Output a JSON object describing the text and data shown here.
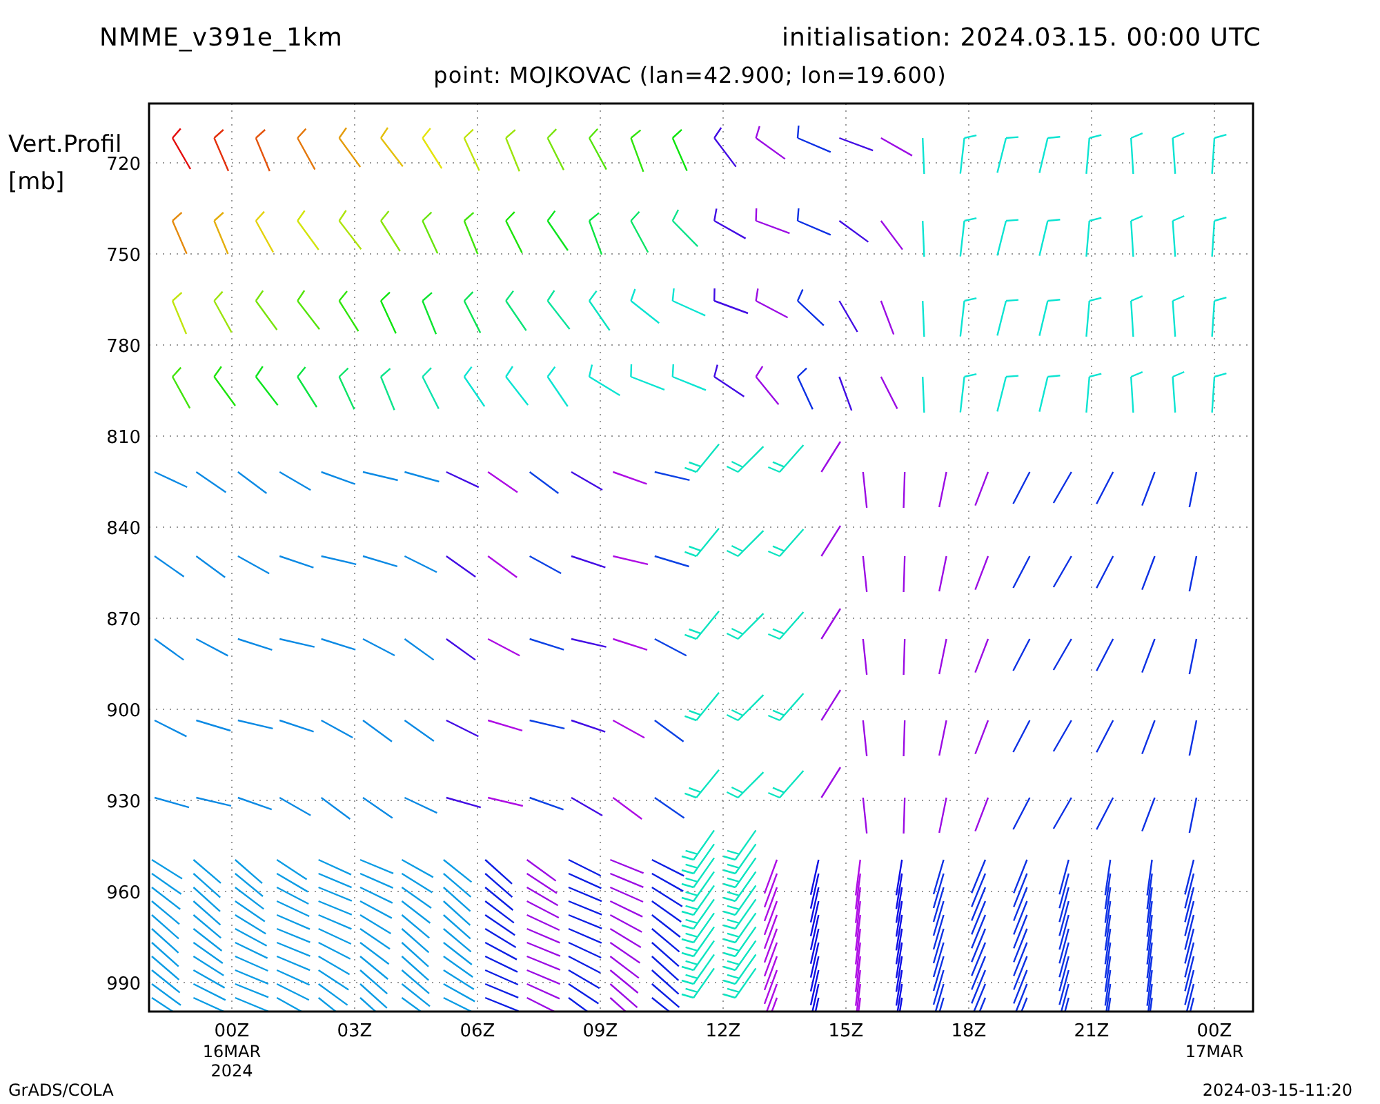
{
  "header": {
    "model": "NMME_v391e_1km",
    "initialisation": "initialisation: 2024.03.15. 00:00 UTC"
  },
  "subtitle": "point: MOJKOVAC (lan=42.900; lon=19.600)",
  "plot": {
    "ylabel_lines": [
      "Vert.Profil",
      "[mb]"
    ],
    "yticks": [
      "720",
      "750",
      "780",
      "810",
      "840",
      "870",
      "900",
      "930",
      "960",
      "990"
    ],
    "xticks": [
      {
        "label": "00Z",
        "sub": [
          "16MAR",
          "2024"
        ]
      },
      {
        "label": "03Z"
      },
      {
        "label": "06Z"
      },
      {
        "label": "09Z"
      },
      {
        "label": "12Z"
      },
      {
        "label": "15Z"
      },
      {
        "label": "18Z"
      },
      {
        "label": "21Z"
      },
      {
        "label": "00Z",
        "sub": [
          "17MAR"
        ]
      }
    ]
  },
  "footer": {
    "left": "GrADS/COLA",
    "right": "2024-03-15-11:20"
  }
}
